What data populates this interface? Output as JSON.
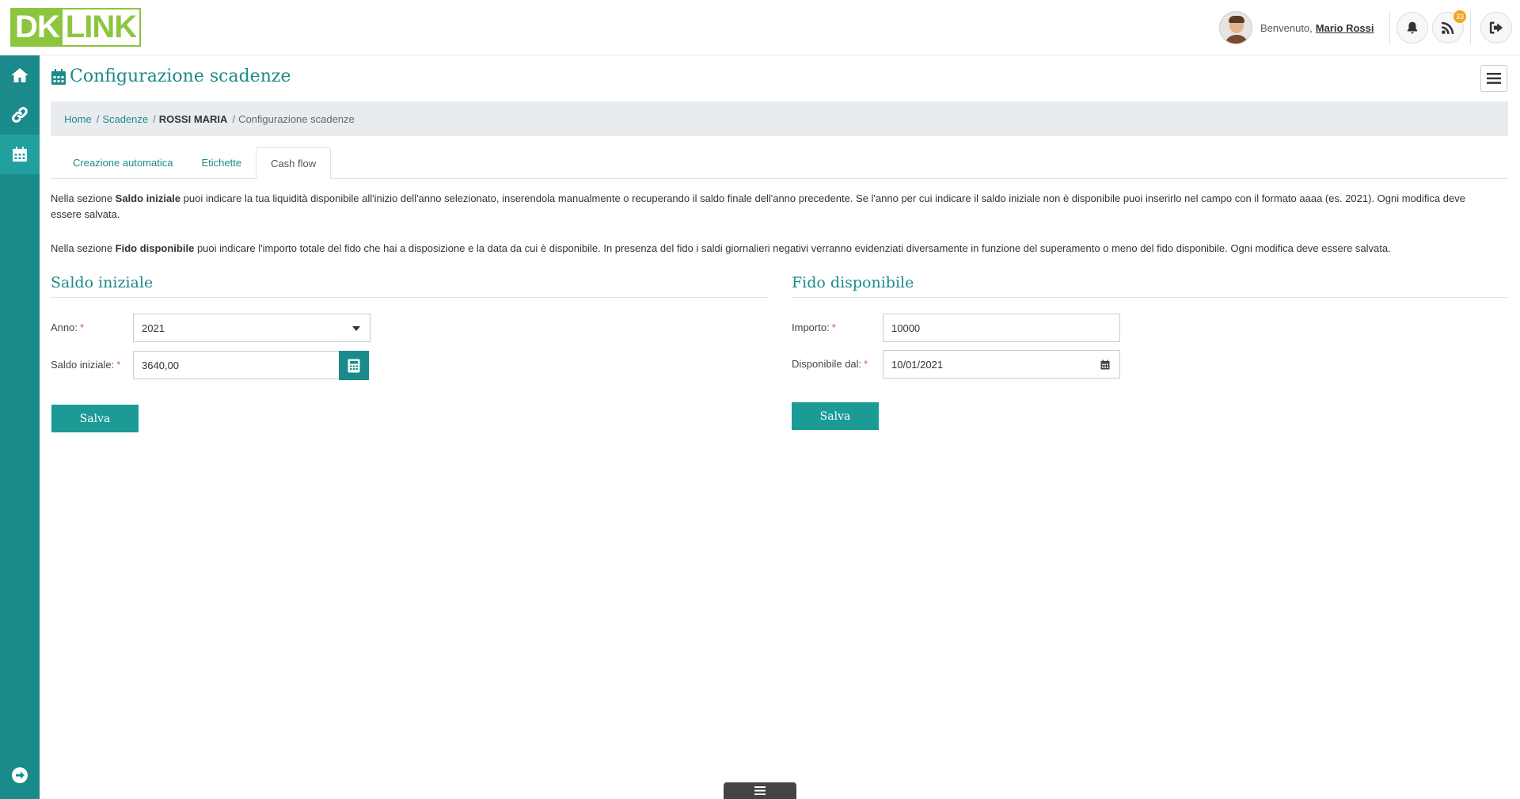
{
  "header": {
    "logo_dk": "DK",
    "logo_link": "LINK",
    "welcome": "Benvenuto,",
    "user_name": "Mario Rossi",
    "feed_badge": "33",
    "icons": [
      "bell-icon",
      "rss-icon",
      "logout-icon"
    ]
  },
  "sidebar": {
    "items": [
      {
        "icon": "home-icon",
        "active": false
      },
      {
        "icon": "link-icon",
        "active": false
      },
      {
        "icon": "calendar-icon",
        "active": true
      }
    ],
    "bottom_icon": "arrow-circle-right-icon"
  },
  "page": {
    "title": "Configurazione scadenze"
  },
  "breadcrumb": {
    "home": "Home",
    "scadenze": "Scadenze",
    "client": "ROSSI MARIA",
    "current": "Configurazione scadenze"
  },
  "tabs": {
    "creazione": "Creazione automatica",
    "etichette": "Etichette",
    "cashflow": "Cash flow",
    "active": "Cash flow"
  },
  "description": {
    "p1_a": "Nella sezione ",
    "p1_bold": "Saldo iniziale",
    "p1_b": " puoi indicare la tua liquidità disponibile all'inizio dell'anno selezionato, inserendola manualmente o recuperando il saldo finale dell'anno precedente. Se l'anno per cui indicare il saldo iniziale non è disponibile puoi inserirlo nel campo con il formato aaaa (es. 2021). Ogni modifica deve essere salvata.",
    "p2_a": "Nella sezione ",
    "p2_bold": "Fido disponibile",
    "p2_b": " puoi indicare l'importo totale del fido che hai a disposizione e la data da cui è disponibile. In presenza del fido i saldi giornalieri negativi verranno evidenziati diversamente in funzione del superamento o meno del fido disponibile. Ogni modifica deve essere salvata."
  },
  "saldo": {
    "title": "Saldo iniziale",
    "anno_label": "Anno:",
    "anno_value": "2021",
    "saldo_label": "Saldo iniziale:",
    "saldo_value": "3640,00",
    "save": "Salva"
  },
  "fido": {
    "title": "Fido disponibile",
    "importo_label": "Importo:",
    "importo_value": "10000",
    "dal_label": "Disponibile dal:",
    "dal_value": "10/01/2021",
    "save": "Salva"
  },
  "required_mark": "*",
  "colors": {
    "primary": "#1b8a8a",
    "logo_green": "#8cc63f",
    "button": "#1b9a96",
    "badge": "#f0a619",
    "required": "#d9534f"
  }
}
